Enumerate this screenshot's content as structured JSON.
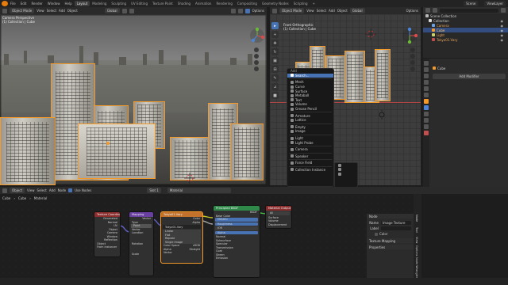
{
  "topbar": {
    "menus": [
      "File",
      "Edit",
      "Render",
      "Window",
      "Help"
    ],
    "workspaces": [
      "Layout",
      "Modeling",
      "Sculpting",
      "UV Editing",
      "Texture Paint",
      "Shading",
      "Animation",
      "Rendering",
      "Compositing",
      "Geometry Nodes",
      "Scripting"
    ],
    "active_workspace": "Layout",
    "scene": "Scene",
    "view_layer": "ViewLayer"
  },
  "left_view": {
    "mode": "Object Mode",
    "menus": [
      "View",
      "Select",
      "Add",
      "Object"
    ],
    "orientation": "Global",
    "options": "Options",
    "title": "Camera Perspective",
    "subtitle": "(1) Collection | Cube"
  },
  "right_view": {
    "mode": "Object Mode",
    "menus": [
      "View",
      "Select",
      "Add",
      "Object"
    ],
    "orientation": "Global",
    "options": "Options",
    "title": "Front Orthographic",
    "subtitle": "(1) Collection | Cube"
  },
  "add_menu": {
    "title": "Add",
    "search": "Search...",
    "items": [
      "Mesh",
      "Curve",
      "Surface",
      "Metaball",
      "Text",
      "Volume",
      "Grease Pencil",
      "Armature",
      "Lattice",
      "Empty",
      "Image",
      "Light",
      "Light Probe",
      "Camera",
      "Speaker",
      "Force Field",
      "Collection Instance"
    ],
    "highlight": "Search..."
  },
  "outliner": {
    "root": "Scene Collection",
    "items": [
      "Collection",
      "Camera",
      "Cube",
      "Light",
      "Tokyo01.Vary"
    ]
  },
  "properties": {
    "object_name": "Cube",
    "add_modifier": "Add Modifier"
  },
  "node_editor": {
    "mode": "Object",
    "menus": [
      "View",
      "Select",
      "Add",
      "Node"
    ],
    "use_nodes": "Use Nodes",
    "slot": "Slot 1",
    "material": "Material",
    "breadcrumb": [
      "Cube",
      "Cube",
      "Material"
    ],
    "nodes": {
      "texcoord": {
        "title": "Texture Coordinate",
        "rows": [
          "Generated",
          "Normal",
          "UV",
          "Object",
          "Camera",
          "Window",
          "Reflection",
          "Object",
          "From Instancer"
        ]
      },
      "mapping": {
        "title": "Mapping",
        "rows": [
          "Vector",
          "Type",
          "Point",
          "Vector",
          "Location",
          "Rotation",
          "Scale"
        ]
      },
      "image": {
        "title": "Tokyo01.Vary",
        "rows": [
          "Color",
          "Alpha",
          "Linear",
          "Flat",
          "Repeat",
          "Single Image",
          "Color Space",
          "sRGB",
          "Alpha",
          "Straight",
          "Vector"
        ]
      },
      "bsdf": {
        "title": "Principled BSDF",
        "rows": [
          "BSDF",
          "Base Color",
          "Metallic",
          "Roughness",
          "IOR",
          "Alpha",
          "Normal",
          "Subsurface",
          "Specular",
          "Transmission",
          "Coat",
          "Sheen",
          "Emission"
        ]
      },
      "output": {
        "title": "Material Output",
        "rows": [
          "All",
          "Surface",
          "Volume",
          "Displacement"
        ]
      }
    }
  },
  "node_panel": {
    "section": "Node",
    "name_label": "Name",
    "name_value": "Image Texture",
    "label_label": "Label",
    "color_label": "Color",
    "texture_mapping": "Texture Mapping",
    "properties": "Properties",
    "tabs": [
      "Node",
      "Tool",
      "View",
      "Options",
      "Node Wrangler"
    ]
  },
  "status": "",
  "colors": {
    "accent": "#4772b3",
    "selection": "#f39a2b",
    "brand": "#e87d0d"
  }
}
